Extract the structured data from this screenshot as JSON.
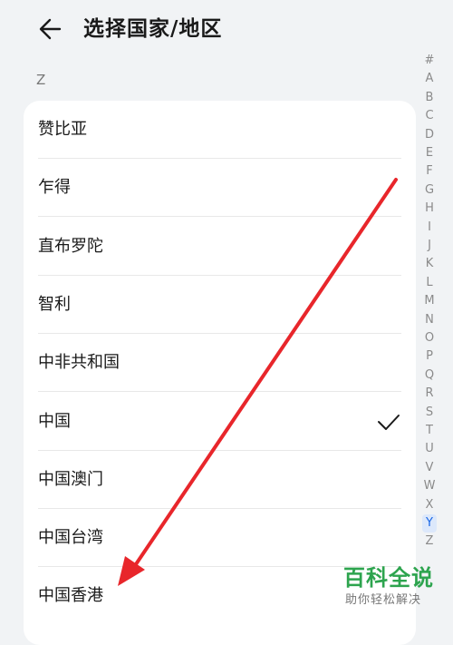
{
  "header": {
    "title": "选择国家/地区"
  },
  "section": {
    "letter": "Z"
  },
  "countries": [
    {
      "label": "赞比亚",
      "selected": false
    },
    {
      "label": "乍得",
      "selected": false
    },
    {
      "label": "直布罗陀",
      "selected": false
    },
    {
      "label": "智利",
      "selected": false
    },
    {
      "label": "中非共和国",
      "selected": false
    },
    {
      "label": "中国",
      "selected": true
    },
    {
      "label": "中国澳门",
      "selected": false
    },
    {
      "label": "中国台湾",
      "selected": false
    },
    {
      "label": "中国香港",
      "selected": false
    }
  ],
  "index_bar": {
    "letters": [
      "#",
      "A",
      "B",
      "C",
      "D",
      "E",
      "F",
      "G",
      "H",
      "I",
      "J",
      "K",
      "L",
      "M",
      "N",
      "O",
      "P",
      "Q",
      "R",
      "S",
      "T",
      "U",
      "V",
      "W",
      "X",
      "Y",
      "Z"
    ],
    "active": "Y"
  },
  "annotation": {
    "arrow_color": "#e8262b"
  },
  "watermark": {
    "logo": "百科全说",
    "subtitle": "助你轻松解决"
  },
  "colors": {
    "background": "#f1f3f5",
    "accent": "#1967e6",
    "watermark_green": "#2da44e"
  },
  "icons": {
    "back": "arrow-left-icon",
    "selected": "checkmark-icon"
  }
}
